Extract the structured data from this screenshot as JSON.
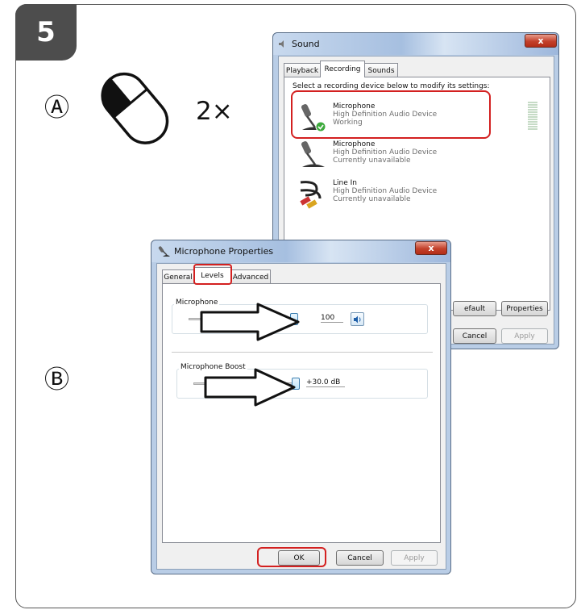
{
  "step": {
    "number": "5"
  },
  "labels": {
    "a": "Ⓐ",
    "b": "Ⓑ",
    "double_click": "2×"
  },
  "sound_dialog": {
    "title": "Sound",
    "close": "x",
    "tabs": [
      "Playback",
      "Recording",
      "Sounds"
    ],
    "instruction": "Select a recording device below to modify its settings:",
    "devices": [
      {
        "name": "Microphone",
        "device": "High Definition Audio Device",
        "status": "Working"
      },
      {
        "name": "Microphone",
        "device": "High Definition Audio Device",
        "status": "Currently unavailable"
      },
      {
        "name": "Line In",
        "device": "High Definition Audio Device",
        "status": "Currently unavailable"
      }
    ],
    "buttons": {
      "default": "efault",
      "properties": "Properties",
      "cancel": "Cancel",
      "apply": "Apply"
    }
  },
  "mic_dialog": {
    "title": "Microphone Properties",
    "close": "x",
    "tabs": [
      "General",
      "Levels",
      "Advanced"
    ],
    "microphone": {
      "label": "Microphone",
      "value": "100",
      "level_fraction": 1.0
    },
    "boost": {
      "label": "Microphone Boost",
      "value": "+30.0 dB",
      "level_fraction": 1.0
    },
    "buttons": {
      "ok": "OK",
      "cancel": "Cancel",
      "apply": "Apply"
    }
  },
  "colors": {
    "highlight": "#d32020",
    "badge": "#4d4d4d"
  }
}
